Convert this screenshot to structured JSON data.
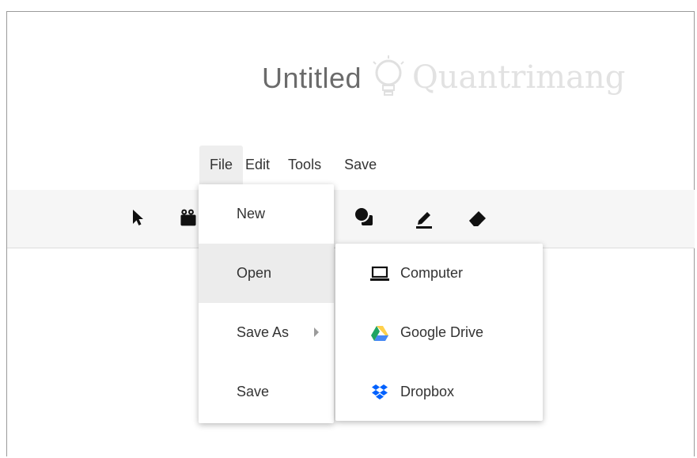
{
  "document": {
    "title": "Untitled"
  },
  "watermark": {
    "text": "Quantrimang"
  },
  "menubar": {
    "items": [
      {
        "label": "File",
        "active": true
      },
      {
        "label": "Edit"
      },
      {
        "label": "Tools"
      },
      {
        "label": "Save"
      }
    ]
  },
  "toolbar": {
    "tools": [
      {
        "icon": "pointer-icon"
      },
      {
        "icon": "film-clip-icon"
      },
      {
        "icon": "shapes-icon"
      },
      {
        "icon": "pencil-icon"
      },
      {
        "icon": "eraser-icon"
      }
    ]
  },
  "file_menu": {
    "items": [
      {
        "label": "New"
      },
      {
        "label": "Open",
        "highlighted": true
      },
      {
        "label": "Save As",
        "has_submenu": true
      },
      {
        "label": "Save"
      }
    ]
  },
  "open_submenu": {
    "items": [
      {
        "label": "Computer",
        "icon": "laptop-icon"
      },
      {
        "label": "Google Drive",
        "icon": "google-drive-icon"
      },
      {
        "label": "Dropbox",
        "icon": "dropbox-icon"
      }
    ]
  },
  "colors": {
    "title": "#6b6b6b",
    "toolbar_bg": "#f6f6f6",
    "menu_active_bg": "#eeeeee",
    "dropbox_blue": "#0061fe",
    "drive_green": "#1fa463",
    "drive_yellow": "#ffd04b",
    "drive_blue": "#4688f4"
  }
}
